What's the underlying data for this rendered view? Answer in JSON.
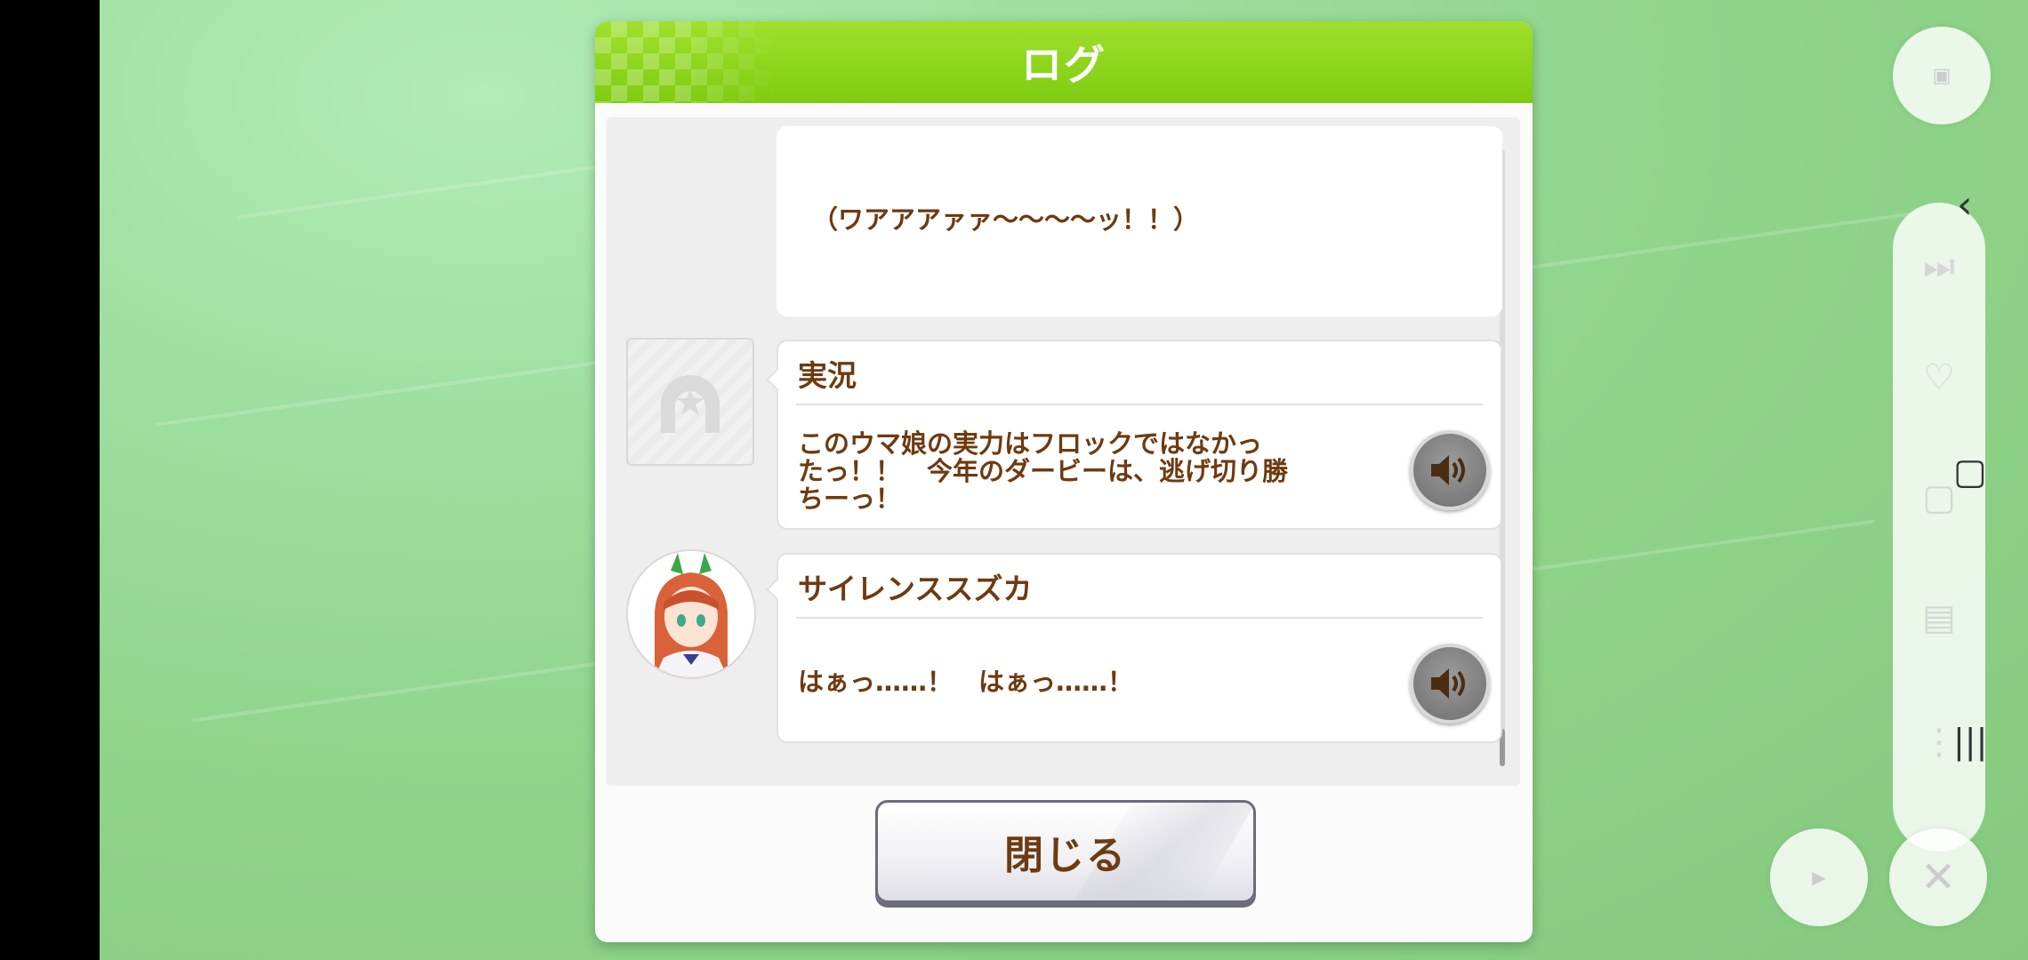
{
  "dialog": {
    "title": "ログ",
    "close_label": "閉じる"
  },
  "log": {
    "entries": [
      {
        "speaker": "",
        "text": "（ワアアアァァ～～～～ッ！！）"
      },
      {
        "speaker": "実況",
        "text": "このウマ娘の実力はフロックではなかったっ！！　今年のダービーは、逃げ切り勝ちーっ！",
        "text_lines": [
          "このウマ娘の実力はフロックではなかっ",
          "たっ！！　今年のダービーは、逃げ切り勝",
          "ちーっ！"
        ]
      },
      {
        "speaker": "サイレンススズカ",
        "text": "はぁっ……！　はぁっ……！"
      }
    ]
  },
  "icons": {
    "voice": "speaker-volume-icon",
    "narrator_avatar": "horseshoe-star-icon",
    "character_avatar": "character-portrait"
  },
  "colors": {
    "header_green": "#8fd61c",
    "text_brown": "#6e3a10"
  }
}
